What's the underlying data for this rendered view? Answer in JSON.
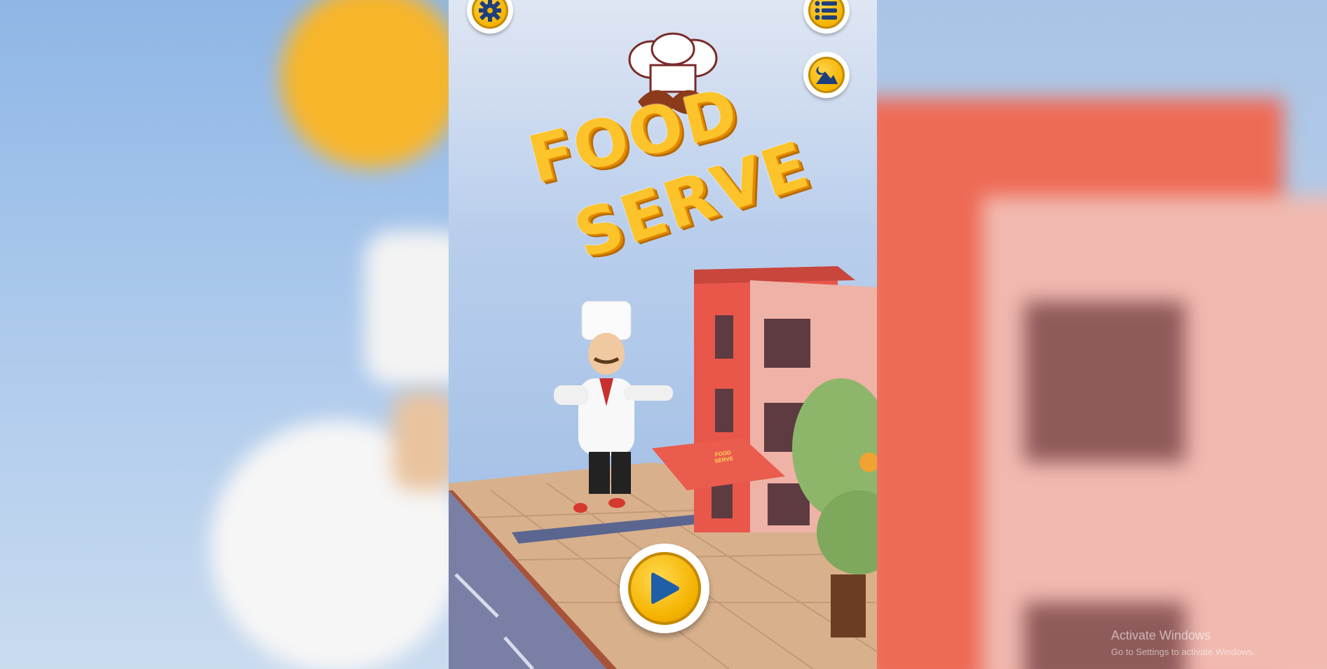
{
  "game": {
    "title_line1": "FOOD",
    "title_line2": "SERVE",
    "sign_text": "FOOD SERVE"
  },
  "buttons": {
    "settings_icon": "gear-icon",
    "menu_icon": "list-icon",
    "theme_icon": "night-mountain-icon",
    "play_icon": "play-icon"
  },
  "watermark": {
    "title": "Activate Windows",
    "subtitle": "Go to Settings to activate Windows."
  },
  "colors": {
    "button_yellow": "#f5b400",
    "title_yellow": "#fcc32a",
    "play_blue": "#1f5fa8",
    "building_red": "#e8574a"
  }
}
